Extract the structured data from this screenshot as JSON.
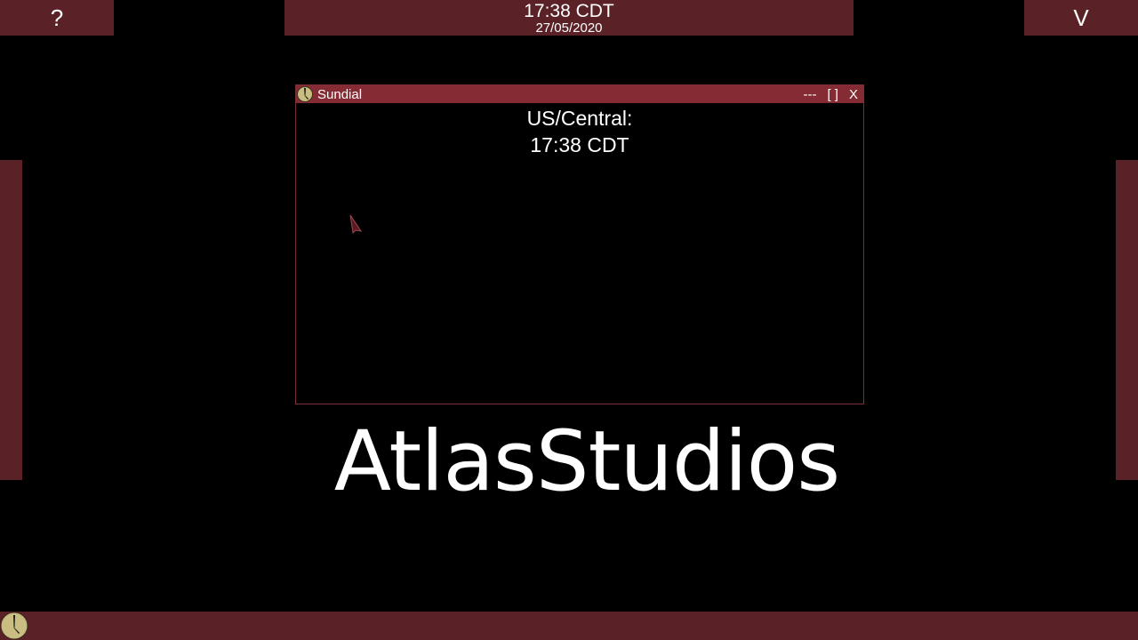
{
  "topbar": {
    "help_label": "?",
    "menu_label": "V",
    "clock_time": "17:38 CDT",
    "clock_date": "27/05/2020"
  },
  "window": {
    "title": "Sundial",
    "icon": "sundial-icon",
    "controls": {
      "minimize": "---",
      "maximize": "[ ]",
      "close": "X"
    },
    "content": {
      "timezone_label": "US/Central:",
      "timezone_time": "17:38 CDT"
    }
  },
  "desktop": {
    "logo_text": "AtlasStudios"
  },
  "taskbar": {
    "start_icon": "sundial-icon"
  },
  "colors": {
    "bar": "#5a2126",
    "titlebar": "#842b33",
    "window_border": "#7a2f34",
    "background": "#000000",
    "text": "#ffffff"
  }
}
